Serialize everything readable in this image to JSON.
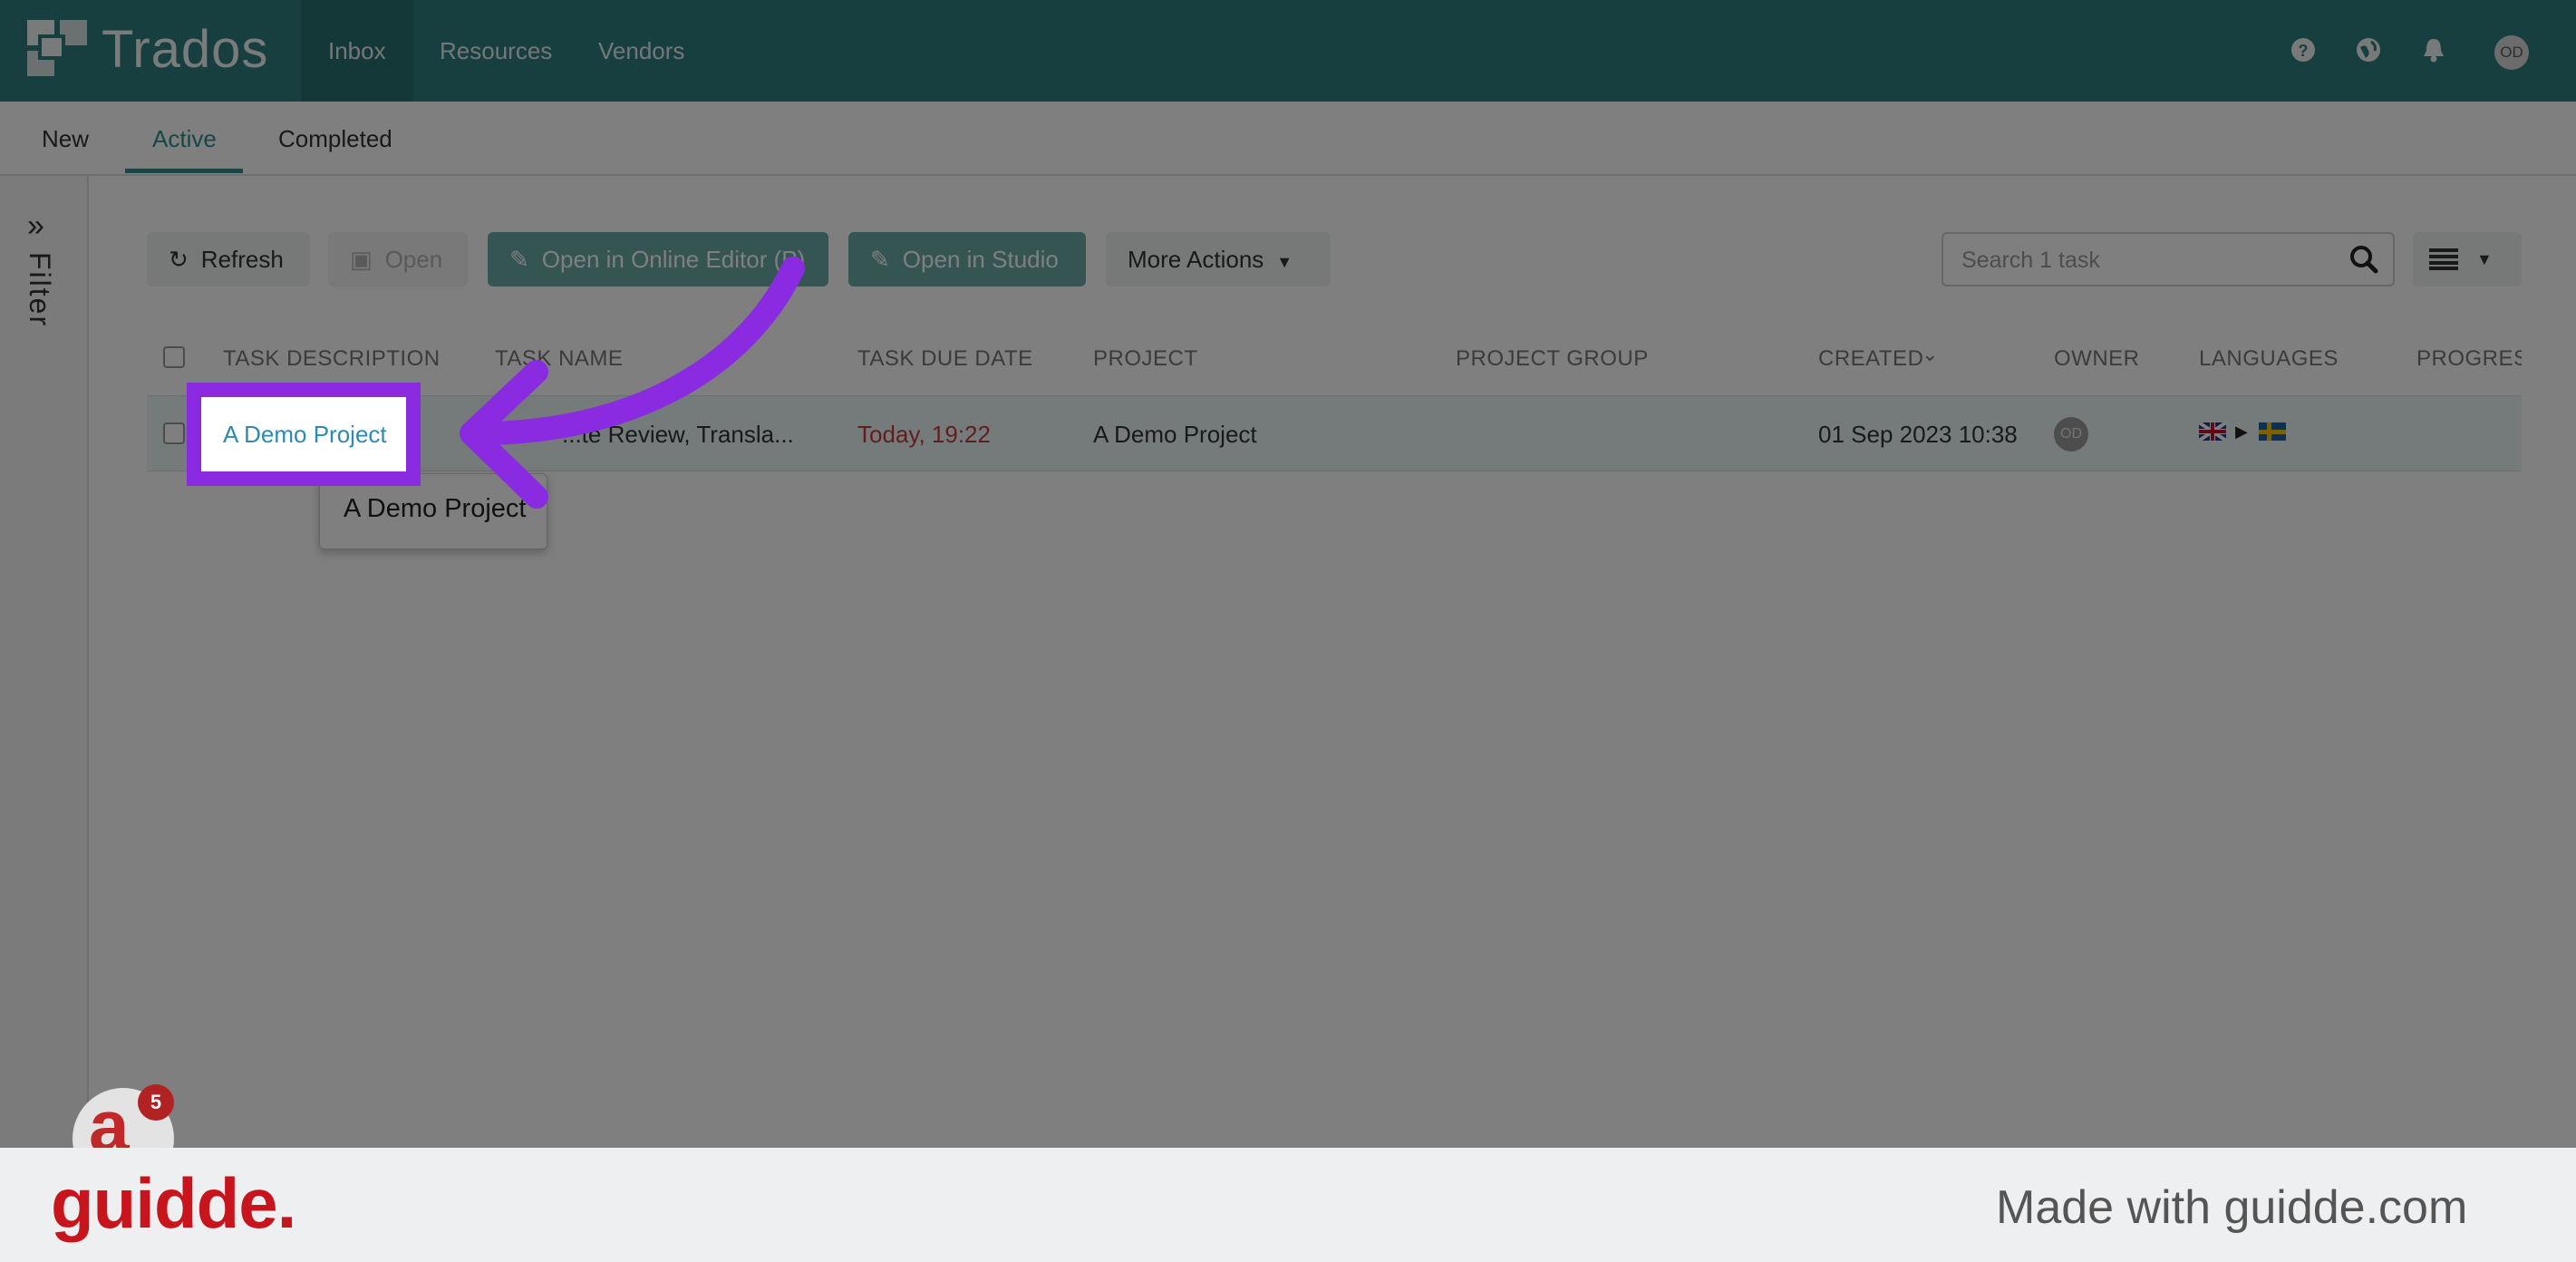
{
  "app": {
    "name": "Trados",
    "nav": [
      "Inbox",
      "Resources",
      "Vendors"
    ],
    "user_initials": "OD"
  },
  "subtabs": [
    "New",
    "Active",
    "Completed"
  ],
  "sidebar": {
    "label": "Filter"
  },
  "toolbar": {
    "refresh": "Refresh",
    "open": "Open",
    "open_online": "Open in Online Editor (P)",
    "open_studio": "Open in Studio",
    "more_actions": "More Actions",
    "search_placeholder": "Search 1 task"
  },
  "table": {
    "headers": [
      "TASK DESCRIPTION",
      "TASK NAME",
      "TASK DUE DATE",
      "PROJECT",
      "PROJECT GROUP",
      "CREATED",
      "OWNER",
      "LANGUAGES",
      "PROGRESS"
    ],
    "rows": [
      {
        "description": "A Demo Project",
        "task_name": "...te Review, Transla...",
        "due": "Today, 19:22",
        "project": "A Demo Project",
        "project_group": "",
        "created": "01 Sep 2023 10:38",
        "owner": "OD",
        "languages": [
          "en-GB",
          "sv-SE"
        ]
      }
    ]
  },
  "tooltip": "A Demo Project",
  "widget": {
    "badge": "5",
    "glyph": "a"
  },
  "footer": {
    "logo": "guidde.",
    "made_with": "Made with guidde.com"
  },
  "colors": {
    "primary": "#2f7f80",
    "accent": "#8a2be2",
    "link": "#2d8ab5",
    "due": "#c83a3a",
    "brand": "#c8141c"
  },
  "icons": [
    "help-icon",
    "globe-icon",
    "bell-icon",
    "refresh-icon",
    "open-icon",
    "edit-icon",
    "caret-down-icon",
    "search-icon",
    "list-view-icon",
    "chevrons-right-icon",
    "sort-desc-icon"
  ]
}
